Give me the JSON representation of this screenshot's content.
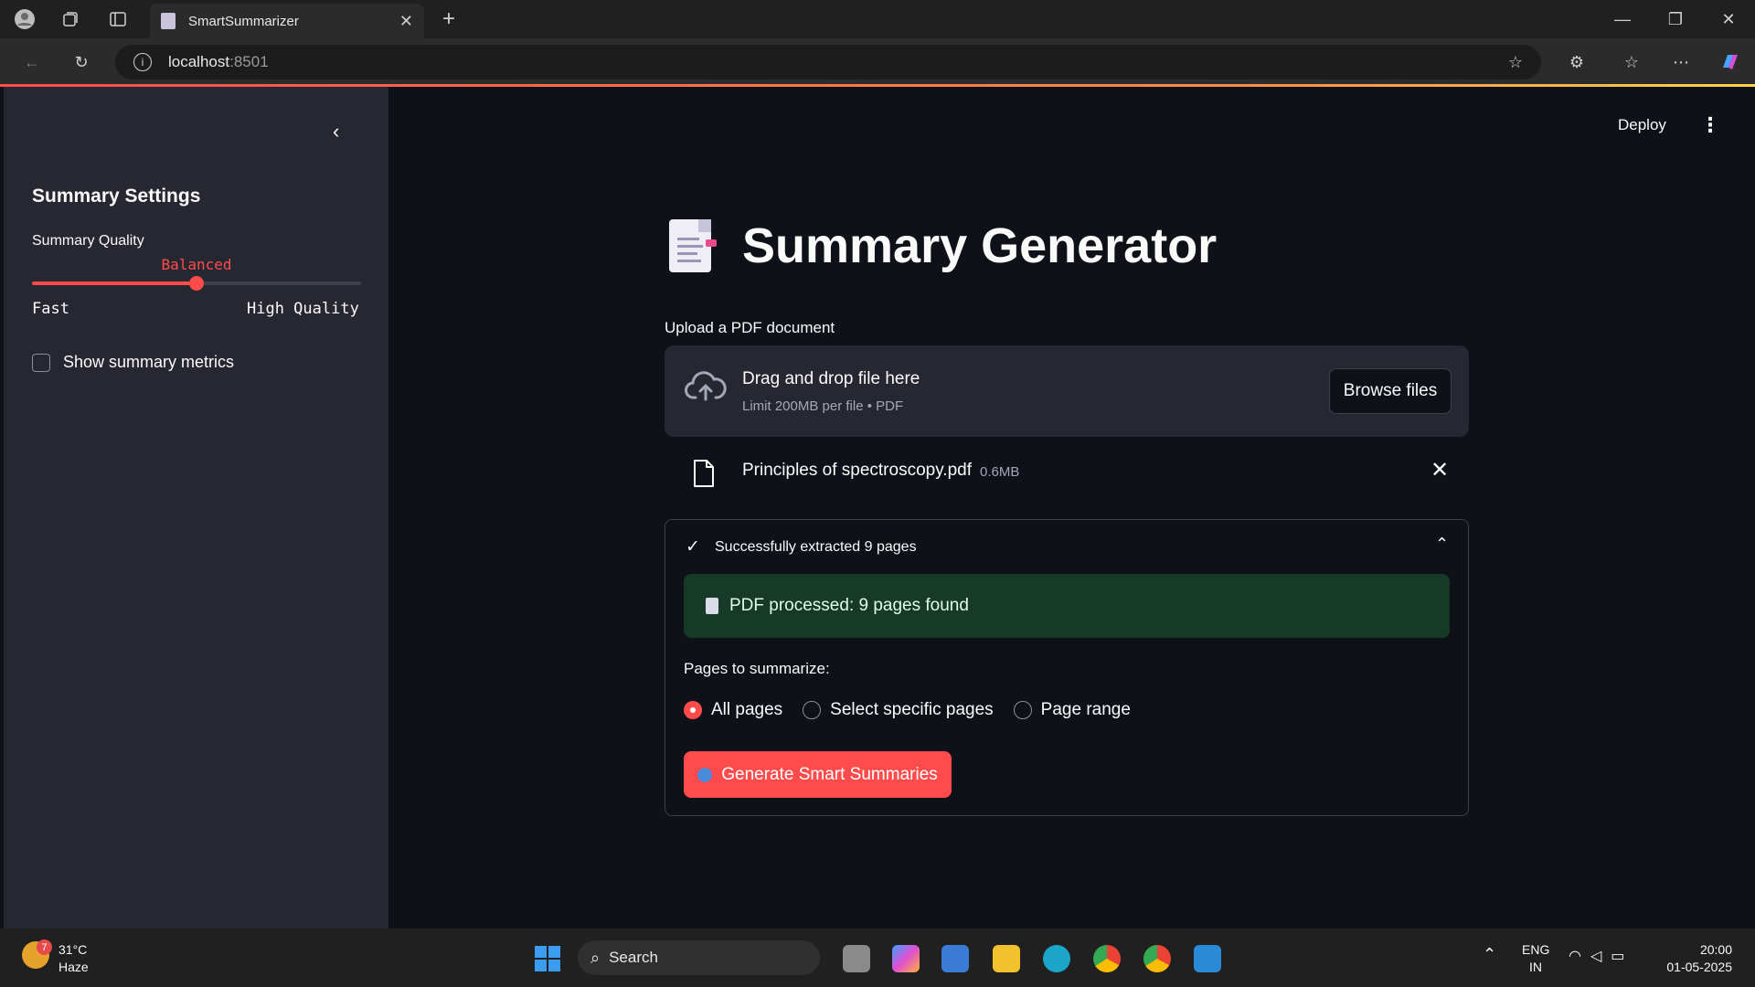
{
  "browser": {
    "tab_title": "SmartSummarizer",
    "url_host": "localhost",
    "url_port": ":8501"
  },
  "sidebar": {
    "title": "Summary Settings",
    "quality_label": "Summary Quality",
    "quality_value": "Balanced",
    "quality_position": 0.5,
    "min_label": "Fast",
    "max_label": "High Quality",
    "metrics_label": "Show summary metrics",
    "metrics_checked": false
  },
  "header": {
    "deploy_label": "Deploy",
    "menu_icon": "more-vertical-icon"
  },
  "main": {
    "title": "Summary Generator",
    "title_icon": "document-icon",
    "upload_label": "Upload a PDF document",
    "drop_title": "Drag and drop file here",
    "drop_limit": "Limit 200MB per file • PDF",
    "browse_label": "Browse files",
    "file_name": "Principles of spectroscopy.pdf",
    "file_size": "0.6MB",
    "expander_title": "Successfully extracted 9 pages",
    "success_text": "PDF processed: 9 pages found",
    "pages_label": "Pages to summarize:",
    "radio_options": [
      "All pages",
      "Select specific pages",
      "Page range"
    ],
    "radio_selected": 0,
    "generate_label": "Generate Smart Summaries"
  },
  "taskbar": {
    "weather_badge": "7",
    "weather_temp": "31°C",
    "weather_desc": "Haze",
    "search_label": "Search",
    "lang_line1": "ENG",
    "lang_line2": "IN",
    "time": "20:00",
    "date": "01-05-2025"
  },
  "colors": {
    "accent": "#ff4b4b",
    "background": "#0e1117",
    "sidebar": "#262730",
    "success_bg": "#173928"
  }
}
